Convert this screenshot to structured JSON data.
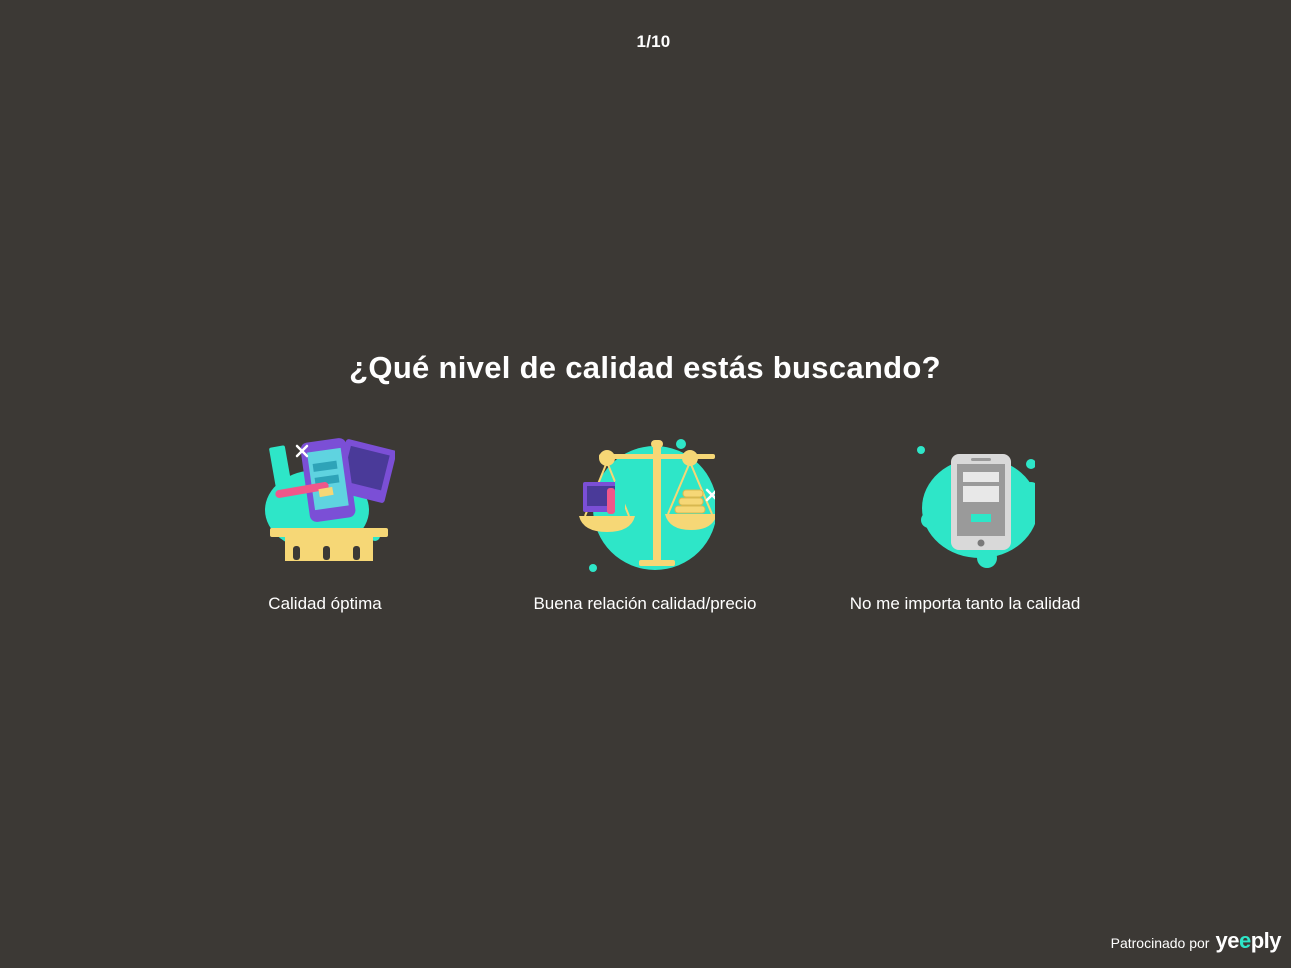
{
  "progress": {
    "counter_text": "1/10"
  },
  "question": {
    "title": "¿Qué nivel de calidad estás buscando?"
  },
  "options": [
    {
      "label": "Calidad óptima",
      "icon": "design-tools-pedestal-icon"
    },
    {
      "label": "Buena relación calidad/precio",
      "icon": "balance-scale-icon"
    },
    {
      "label": "No me importa tanto la calidad",
      "icon": "smartphone-icon"
    }
  ],
  "footer": {
    "sponsor_text": "Patrocinado por",
    "brand_pre": "ye",
    "brand_accent": "e",
    "brand_post": "ply"
  },
  "colors": {
    "background": "#3c3935",
    "accent": "#2ee6c8",
    "purple": "#7b4fd6",
    "yellow": "#f6d776",
    "pink": "#f0578a"
  }
}
